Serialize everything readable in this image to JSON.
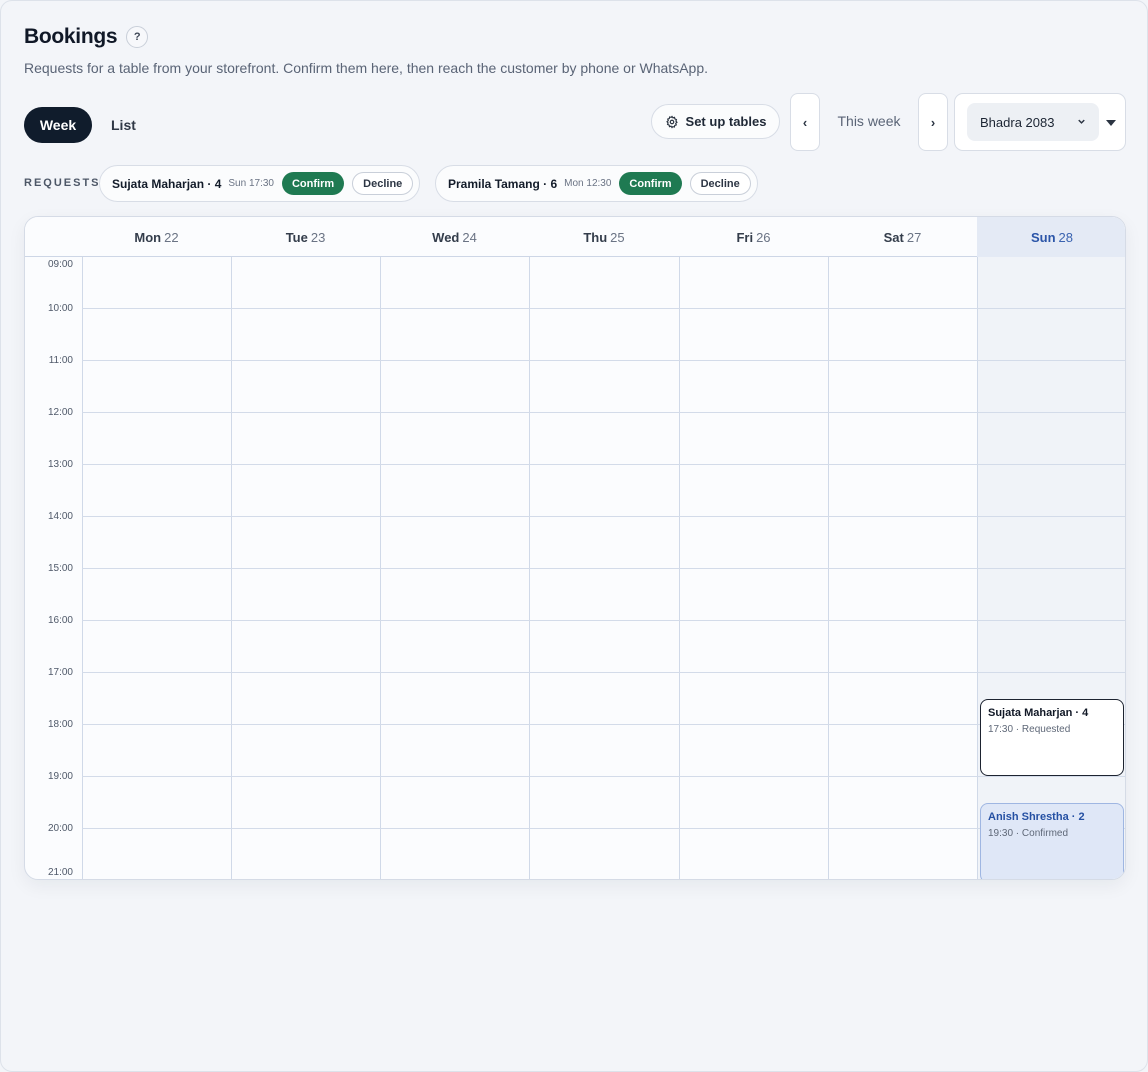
{
  "header": {
    "title": "Bookings",
    "help": "?",
    "subtitle": "Requests for a table from your storefront. Confirm them here, then reach the customer by phone or WhatsApp."
  },
  "view_toggle": {
    "week": "Week",
    "list": "List",
    "selected": "Week"
  },
  "toolbar": {
    "setup_tables": "Set up tables",
    "prev": "‹",
    "next": "›",
    "week_label": "This week",
    "calendar_month": "Bhadra 2083"
  },
  "requests": {
    "label": "REQUESTS",
    "items": [
      {
        "name": "Sujata Maharjan · 4",
        "time": "Sun 17:30",
        "confirm": "Confirm",
        "decline": "Decline"
      },
      {
        "name": "Pramila Tamang · 6",
        "time": "Mon 12:30",
        "confirm": "Confirm",
        "decline": "Decline"
      }
    ]
  },
  "calendar": {
    "days": [
      {
        "name": "Mon",
        "date": "22"
      },
      {
        "name": "Tue",
        "date": "23"
      },
      {
        "name": "Wed",
        "date": "24"
      },
      {
        "name": "Thu",
        "date": "25"
      },
      {
        "name": "Fri",
        "date": "26"
      },
      {
        "name": "Sat",
        "date": "27"
      },
      {
        "name": "Sun",
        "date": "28"
      }
    ],
    "today_index": 6,
    "hours": [
      "09:00",
      "10:00",
      "11:00",
      "12:00",
      "13:00",
      "14:00",
      "15:00",
      "16:00",
      "17:00",
      "18:00",
      "19:00",
      "20:00",
      "21:00"
    ],
    "events": [
      {
        "day": "Sun",
        "title": "Sujata Maharjan · 4",
        "subtitle": "17:30 · Requested",
        "status": "requested"
      },
      {
        "day": "Sun",
        "title": "Anish Shrestha · 2",
        "subtitle": "19:30 · Confirmed",
        "status": "confirmed"
      }
    ]
  },
  "colors": {
    "primary_dark": "#101c2c",
    "confirm_green": "#1f7a52",
    "today_blue": "#2b55a8",
    "confirmed_event_bg": "#dfe7f7"
  }
}
